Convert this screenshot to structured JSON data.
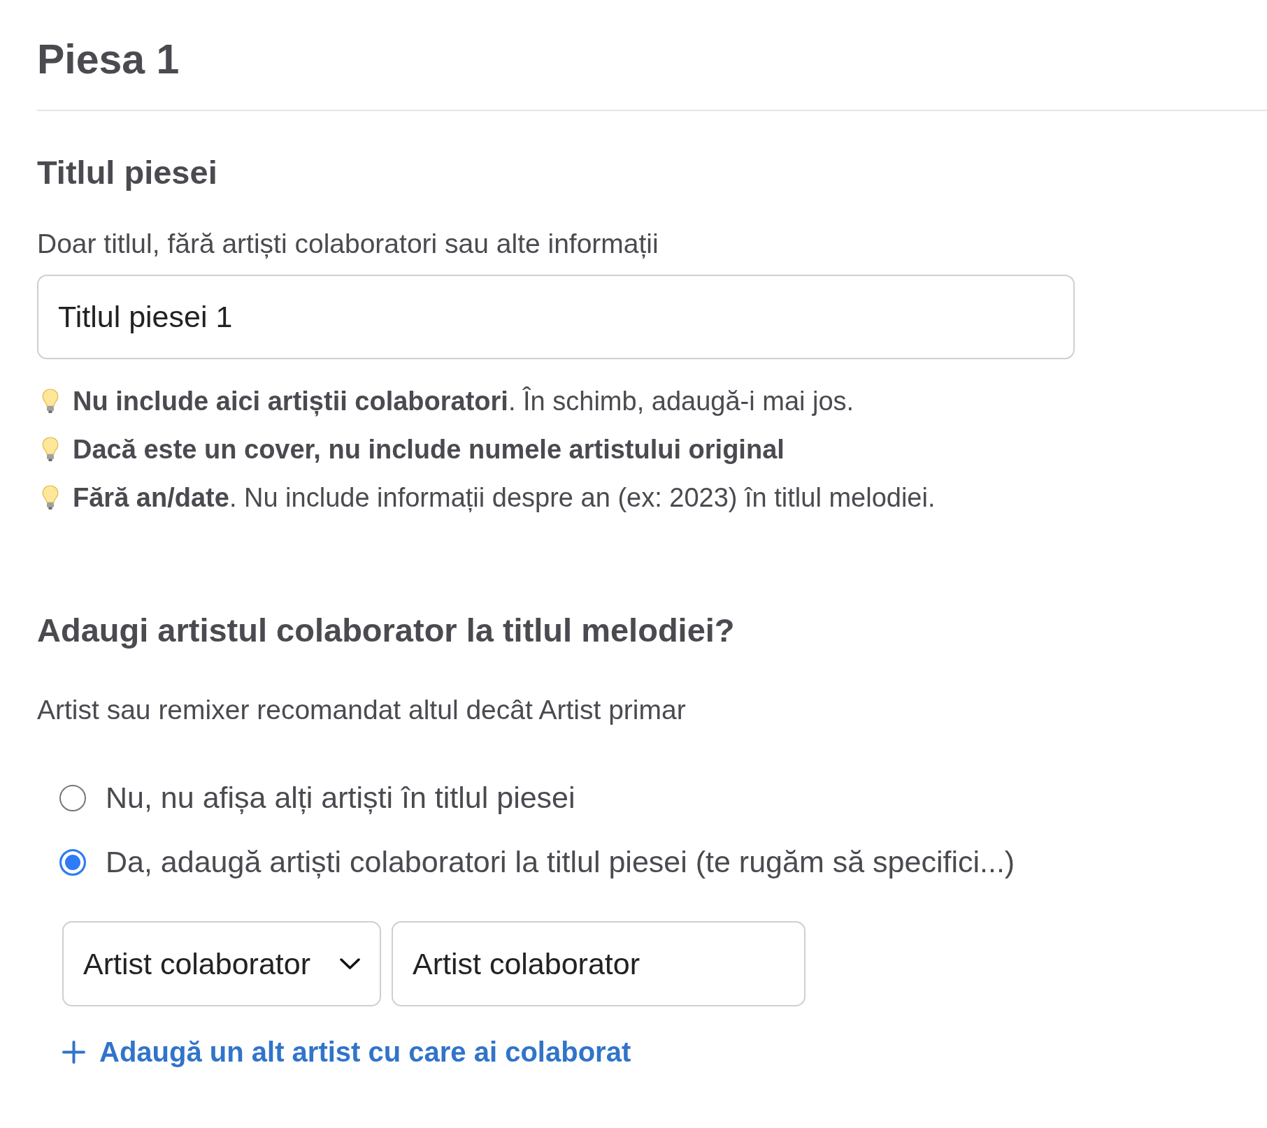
{
  "page_title": "Piesa 1",
  "title_section": {
    "heading": "Titlul piesei",
    "help_text": "Doar titlul, fără artiști colaboratori sau alte informații",
    "input": {
      "value": "Titlul piesei 1"
    },
    "tips": [
      {
        "text": "**Nu include aici artiștii colaboratori**. În schimb, adaugă-i mai jos.",
        "bold": false
      },
      {
        "text": "Dacă este un cover, nu include numele artistului original",
        "bold": true
      },
      {
        "text": "**Fără an/date**. Nu include informații despre an (ex: 2023) în titlul melodiei.",
        "bold": false
      }
    ]
  },
  "collaborator_section": {
    "heading": "Adaugi artistul colaborator la titlul melodiei?",
    "help_text": "Artist sau remixer recomandat altul decât Artist primar",
    "options": [
      {
        "label": "Nu, nu afișa alți artiști în titlul piesei",
        "selected": false
      },
      {
        "label": "Da, adaugă artiști colaboratori la titlul piesei (te rugăm să specifici...)",
        "selected": true
      }
    ],
    "artist_row": {
      "role_select": {
        "value": "Artist colaborator"
      },
      "name_input": {
        "value": "Artist colaborator"
      }
    },
    "add_link": {
      "label": "Adaugă un alt artist cu care ai colaborat"
    }
  }
}
